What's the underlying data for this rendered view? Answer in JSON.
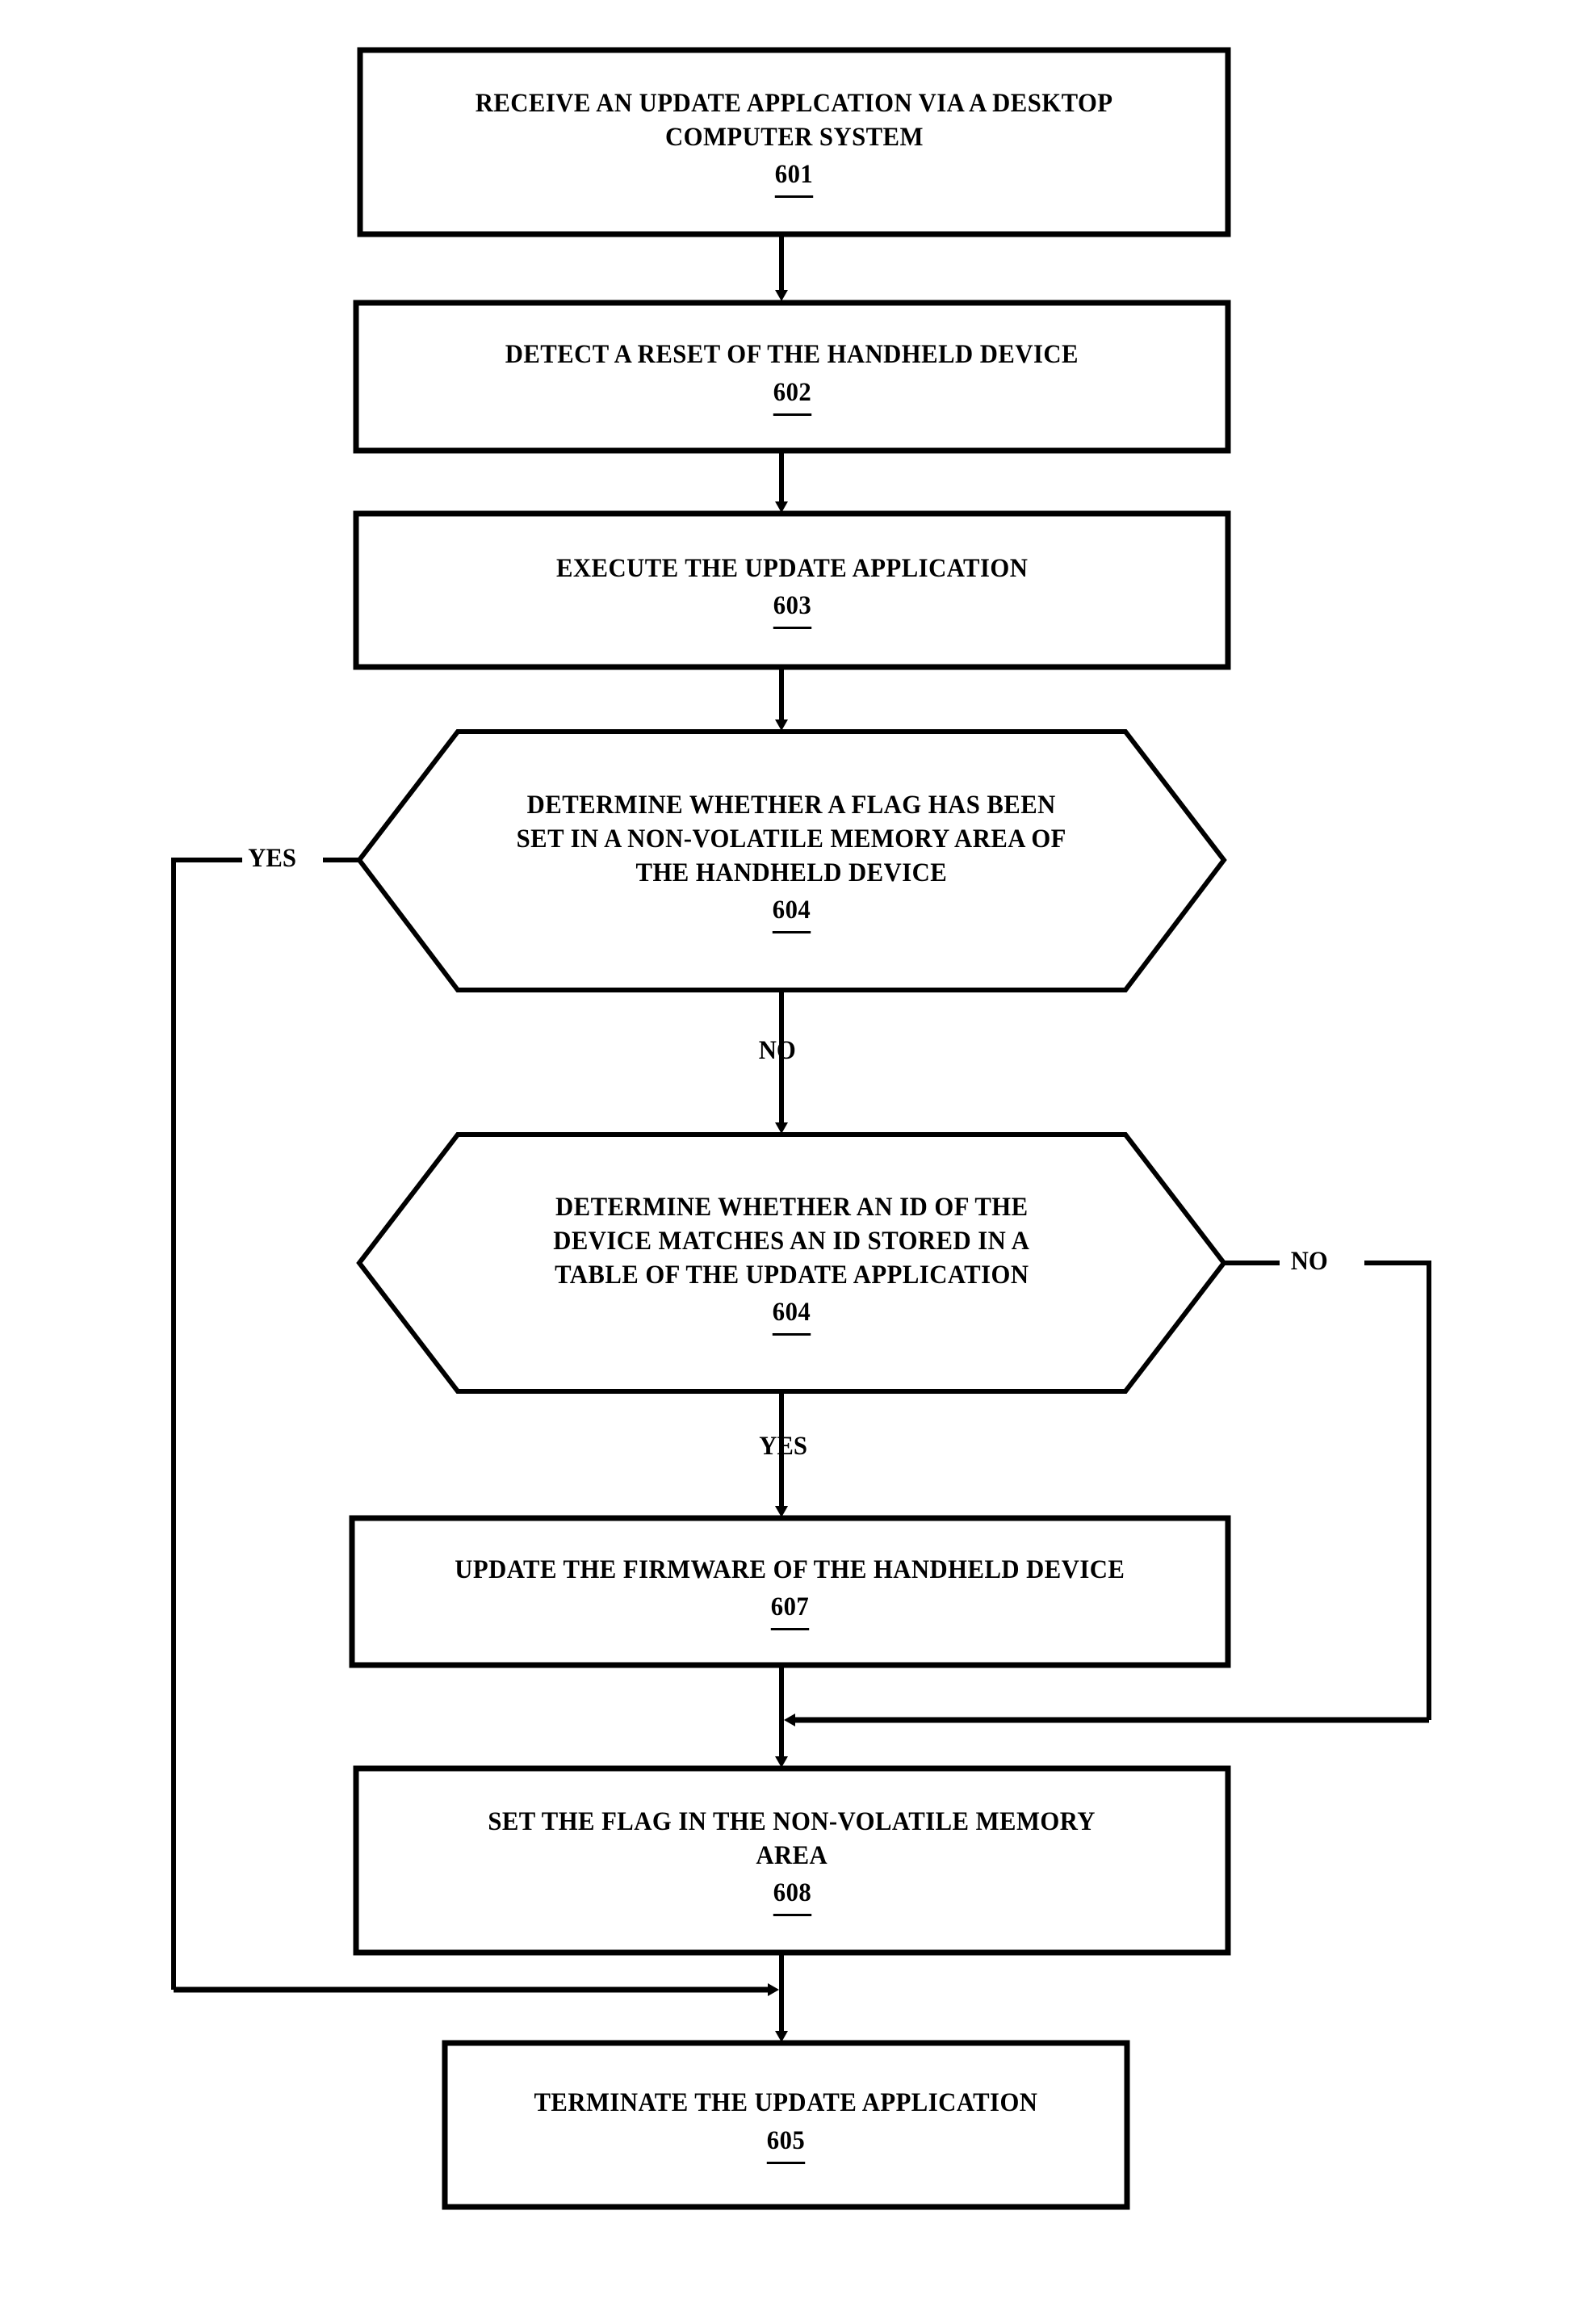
{
  "figure": {
    "type": "flowchart",
    "title": "Firmware update process flowchart",
    "orientation": "vertical",
    "stroke_color": "#000000",
    "background_color": "#ffffff"
  },
  "nodes": [
    {
      "id": "n601",
      "shape": "rectangle",
      "lines": [
        "RECEIVE AN UPDATE APPLCATION VIA A DESKTOP",
        "COMPUTER SYSTEM"
      ],
      "ref": "601"
    },
    {
      "id": "n602",
      "shape": "rectangle",
      "lines": [
        "DETECT A RESET OF THE HANDHELD DEVICE"
      ],
      "ref": "602"
    },
    {
      "id": "n603",
      "shape": "rectangle",
      "lines": [
        "EXECUTE THE UPDATE APPLICATION"
      ],
      "ref": "603"
    },
    {
      "id": "n604a",
      "shape": "hexagon",
      "lines": [
        "DETERMINE WHETHER A FLAG HAS BEEN",
        "SET IN A NON-VOLATILE MEMORY AREA OF",
        "THE HANDHELD DEVICE"
      ],
      "ref": "604"
    },
    {
      "id": "n604b",
      "shape": "hexagon",
      "lines": [
        "DETERMINE WHETHER AN ID OF THE",
        "DEVICE MATCHES AN ID STORED IN A",
        "TABLE OF THE UPDATE APPLICATION"
      ],
      "ref": "604"
    },
    {
      "id": "n607",
      "shape": "rectangle",
      "lines": [
        "UPDATE THE FIRMWARE OF THE HANDHELD DEVICE"
      ],
      "ref": "607"
    },
    {
      "id": "n608",
      "shape": "rectangle",
      "lines": [
        "SET THE FLAG IN THE NON-VOLATILE MEMORY",
        "AREA"
      ],
      "ref": "608"
    },
    {
      "id": "n605",
      "shape": "rectangle",
      "lines": [
        "TERMINATE THE UPDATE APPLICATION"
      ],
      "ref": "605"
    }
  ],
  "edges": [
    {
      "id": "e1",
      "from": "n601",
      "to": "n602",
      "label": ""
    },
    {
      "id": "e2",
      "from": "n602",
      "to": "n603",
      "label": ""
    },
    {
      "id": "e3",
      "from": "n603",
      "to": "n604a",
      "label": ""
    },
    {
      "id": "e4",
      "from": "n604a",
      "to": "n605",
      "label": "YES"
    },
    {
      "id": "e5",
      "from": "n604a",
      "to": "n604b",
      "label": "NO"
    },
    {
      "id": "e6",
      "from": "n604b",
      "to": "n608",
      "label": "NO"
    },
    {
      "id": "e7",
      "from": "n604b",
      "to": "n607",
      "label": "YES"
    },
    {
      "id": "e8",
      "from": "n607",
      "to": "n608",
      "label": ""
    },
    {
      "id": "e9",
      "from": "n608",
      "to": "n605",
      "label": ""
    }
  ],
  "edge_labels": {
    "yes_flag": "YES",
    "no_flag": "NO",
    "no_id": "NO",
    "yes_id": "YES"
  }
}
